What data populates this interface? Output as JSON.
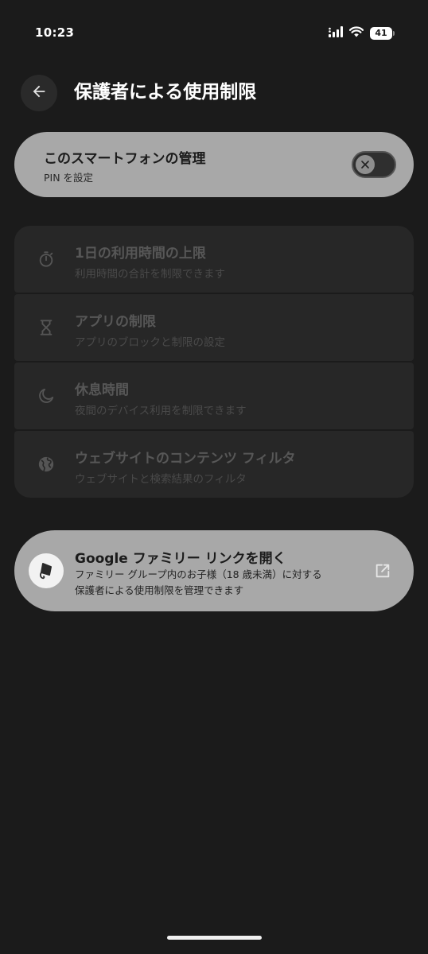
{
  "status_bar": {
    "time": "10:23",
    "battery_level": "41"
  },
  "header": {
    "title": "保護者による使用制限"
  },
  "manage_card": {
    "title": "このスマートフォンの管理",
    "subtitle": "PIN を設定",
    "toggle_enabled": false
  },
  "settings": [
    {
      "title": "1日の利用時間の上限",
      "subtitle": "利用時間の合計を制限できます",
      "icon": "timer-icon"
    },
    {
      "title": "アプリの制限",
      "subtitle": "アプリのブロックと制限の設定",
      "icon": "hourglass-icon"
    },
    {
      "title": "休息時間",
      "subtitle": "夜間のデバイス利用を制限できます",
      "icon": "moon-icon"
    },
    {
      "title": "ウェブサイトのコンテンツ フィルタ",
      "subtitle": "ウェブサイトと検索結果のフィルタ",
      "icon": "globe-icon"
    }
  ],
  "family_link": {
    "title": "Google ファミリー リンクを開く",
    "description_line1": "ファミリー グループ内のお子様（18 歳未満）に対する",
    "description_line2": "保護者による使用制限を管理できます",
    "icon": "family-link-icon",
    "action_icon": "open-external-icon"
  },
  "colors": {
    "background": "#1b1b1b",
    "card_active": "#a8a8a8",
    "card_disabled": "#272727"
  }
}
